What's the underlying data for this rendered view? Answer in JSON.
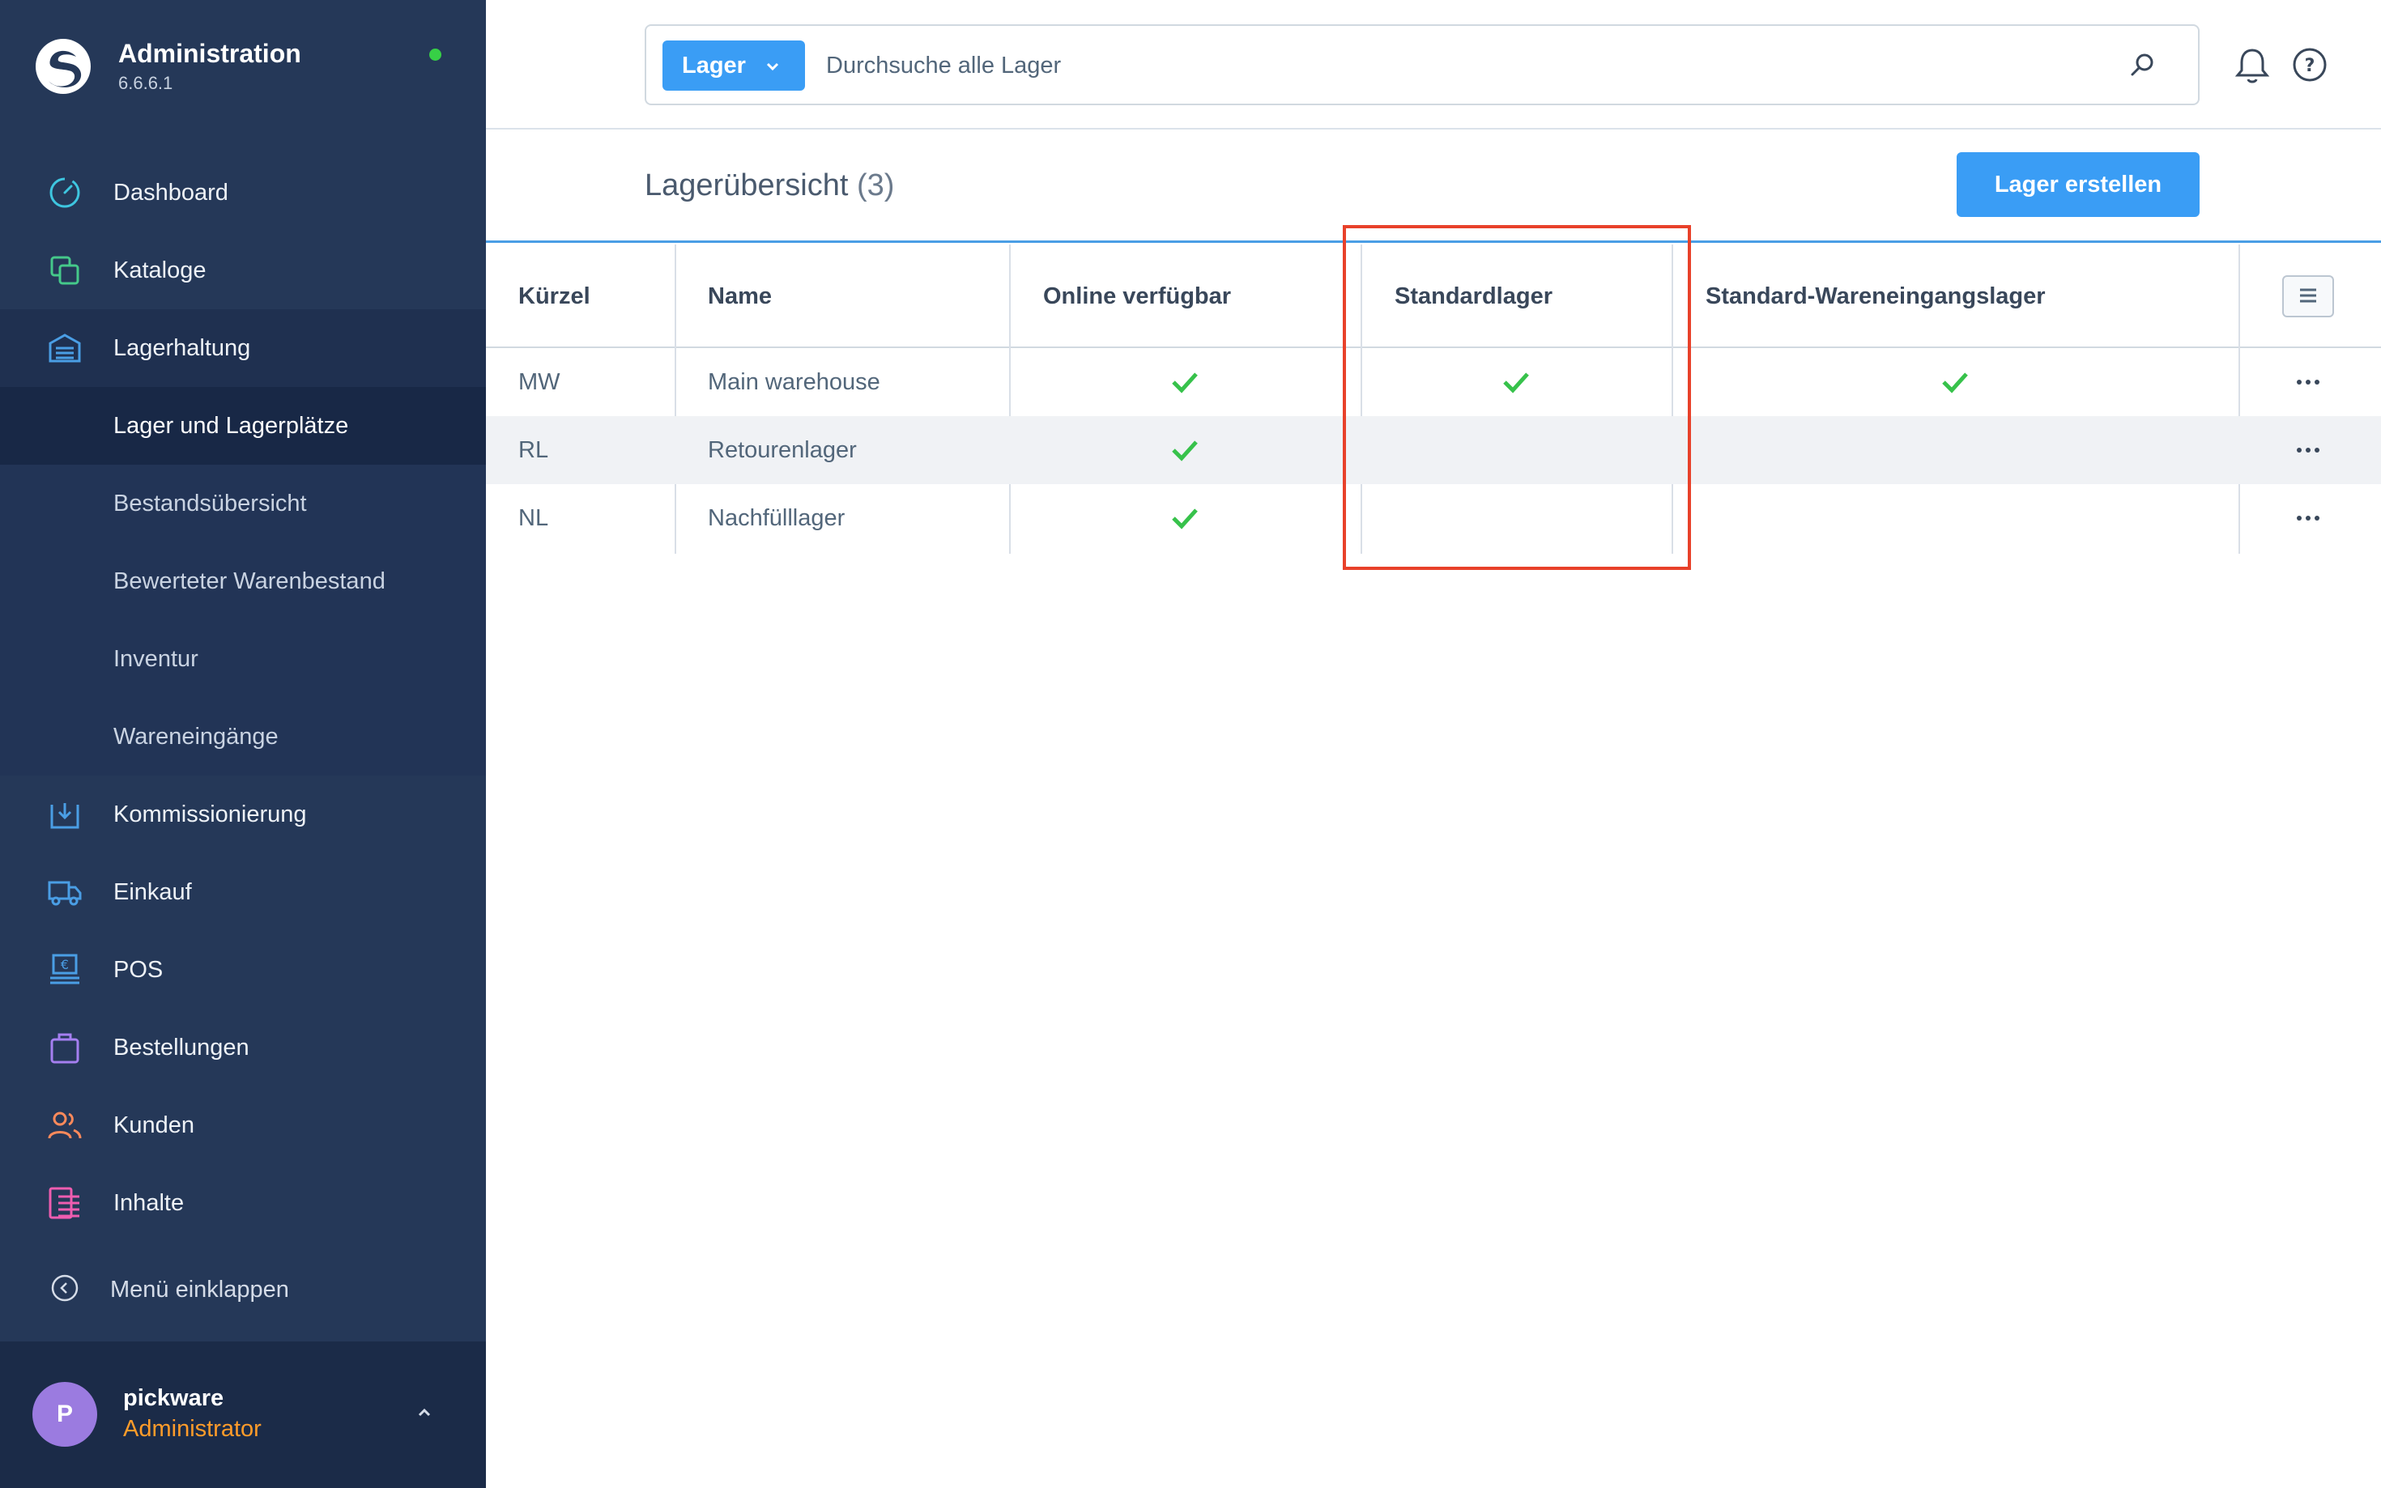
{
  "app": {
    "title": "Administration",
    "version": "6.6.6.1"
  },
  "sidebar": {
    "items": [
      {
        "label": "Dashboard",
        "icon": "dashboard-icon"
      },
      {
        "label": "Kataloge",
        "icon": "catalog-icon"
      },
      {
        "label": "Lagerhaltung",
        "icon": "warehouse-icon"
      },
      {
        "label": "Kommissionierung",
        "icon": "picking-icon"
      },
      {
        "label": "Einkauf",
        "icon": "truck-icon"
      },
      {
        "label": "POS",
        "icon": "pos-icon"
      },
      {
        "label": "Bestellungen",
        "icon": "bag-icon"
      },
      {
        "label": "Kunden",
        "icon": "users-icon"
      },
      {
        "label": "Inhalte",
        "icon": "content-icon"
      }
    ],
    "subitems": [
      {
        "label": "Lager und Lagerplätze"
      },
      {
        "label": "Bestandsübersicht"
      },
      {
        "label": "Bewerteter Warenbestand"
      },
      {
        "label": "Inventur"
      },
      {
        "label": "Wareneingänge"
      }
    ],
    "collapse_label": "Menü einklappen",
    "colors": {
      "background": "#253858",
      "active": "#1f3050",
      "selected": "#182846"
    }
  },
  "user": {
    "initial": "P",
    "name": "pickware",
    "role": "Administrator"
  },
  "search": {
    "type_label": "Lager",
    "placeholder": "Durchsuche alle Lager"
  },
  "header": {
    "title": "Lagerübersicht",
    "count": "(3)",
    "create_button": "Lager erstellen"
  },
  "table": {
    "columns": [
      "Kürzel",
      "Name",
      "Online verfügbar",
      "Standardlager",
      "Standard-Wareneingangslager"
    ],
    "rows": [
      {
        "code": "MW",
        "name": "Main warehouse",
        "online": true,
        "default": true,
        "default_receiving": true
      },
      {
        "code": "RL",
        "name": "Retourenlager",
        "online": true,
        "default": false,
        "default_receiving": false
      },
      {
        "code": "NL",
        "name": "Nachfülllager",
        "online": true,
        "default": false,
        "default_receiving": false
      }
    ]
  },
  "colors": {
    "accent": "#3a9df5",
    "check": "#37c24b",
    "highlight": "#e8412a",
    "online_dot": "#37d046"
  }
}
